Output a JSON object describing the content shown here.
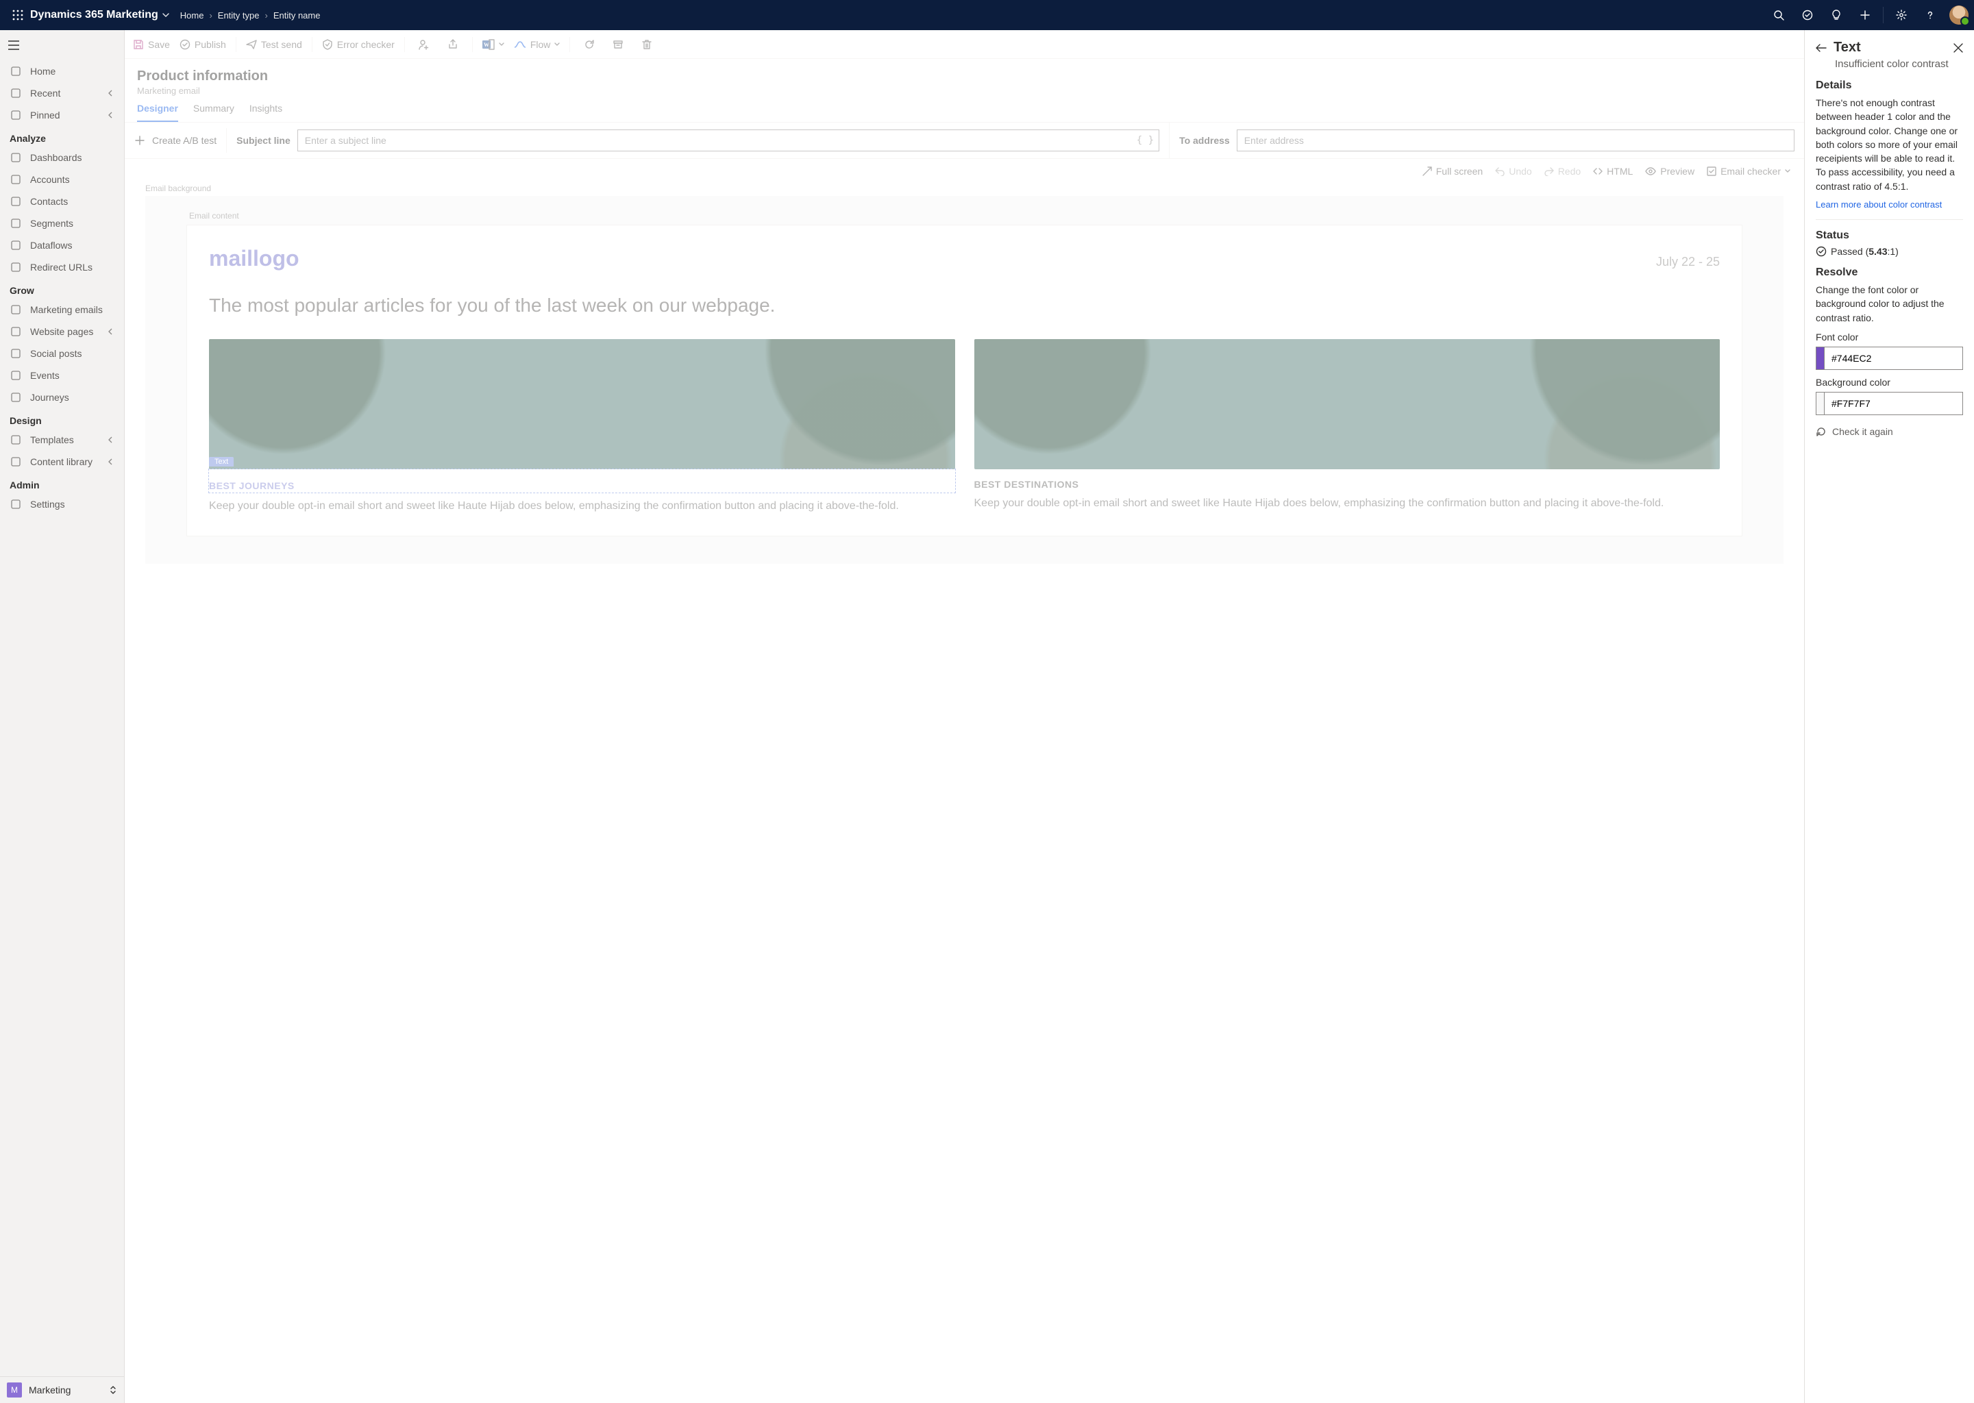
{
  "header": {
    "app_name": "Dynamics 365 Marketing",
    "breadcrumb": [
      "Home",
      "Entity type",
      "Entity name"
    ]
  },
  "sidebar": {
    "items_top": [
      {
        "icon": "home",
        "label": "Home"
      },
      {
        "icon": "clock",
        "label": "Recent",
        "expand": true
      },
      {
        "icon": "pin",
        "label": "Pinned",
        "expand": true
      }
    ],
    "groups": [
      {
        "label": "Analyze",
        "items": [
          {
            "icon": "dash",
            "label": "Dashboards"
          },
          {
            "icon": "briefcase",
            "label": "Accounts"
          },
          {
            "icon": "person",
            "label": "Contacts"
          },
          {
            "icon": "seg",
            "label": "Segments"
          },
          {
            "icon": "flow",
            "label": "Dataflows"
          },
          {
            "icon": "redir",
            "label": "Redirect URLs"
          }
        ]
      },
      {
        "label": "Grow",
        "items": [
          {
            "icon": "mail",
            "label": "Marketing emails"
          },
          {
            "icon": "page",
            "label": "Website pages",
            "expand": true
          },
          {
            "icon": "share",
            "label": "Social posts"
          },
          {
            "icon": "cal",
            "label": "Events"
          },
          {
            "icon": "journey",
            "label": "Journeys"
          }
        ]
      },
      {
        "label": "Design",
        "items": [
          {
            "icon": "template",
            "label": "Templates",
            "expand": true
          },
          {
            "icon": "library",
            "label": "Content library",
            "expand": true
          }
        ]
      },
      {
        "label": "Admin",
        "items": [
          {
            "icon": "gear",
            "label": "Settings"
          }
        ]
      }
    ],
    "area": {
      "initial": "M",
      "label": "Marketing"
    }
  },
  "cmdbar": {
    "save": "Save",
    "publish": "Publish",
    "test": "Test send",
    "error": "Error checker",
    "flow": "Flow"
  },
  "page": {
    "title": "Product information",
    "subtitle": "Marketing email"
  },
  "tabs": [
    "Designer",
    "Summary",
    "Insights"
  ],
  "fields": {
    "ab": "Create A/B test",
    "subject_lbl": "Subject line",
    "subject_ph": "Enter a subject line",
    "to_lbl": "To address",
    "to_ph": "Enter address"
  },
  "tools": {
    "full": "Full screen",
    "undo": "Undo",
    "redo": "Redo",
    "html": "HTML",
    "preview": "Preview",
    "checker": "Email checker"
  },
  "email": {
    "bg_label": "Email background",
    "content_label": "Email content",
    "logo": "maillogo",
    "date": "July 22 - 25",
    "headline": "The most popular articles for you of the last week on our webpage.",
    "cards": [
      {
        "cat": "BEST JOURNEYS",
        "desc": "Keep your double opt-in email short and sweet like Haute Hijab does below, emphasizing the confirmation button and placing it above-the-fold."
      },
      {
        "cat": "BEST DESTINATIONS",
        "desc": "Keep your double opt-in email short and sweet like Haute Hijab does below, emphasizing the confirmation button and placing it above-the-fold."
      }
    ],
    "sel_tag": "Text"
  },
  "panel": {
    "title": "Text",
    "subtitle": "Insufficient color contrast",
    "details_h": "Details",
    "details": "There's not enough contrast between header 1 color and the background color. Change one or both colors so more of your email receipients will be able to read it. To pass accessibility, you need a contrast ratio of 4.5:1.",
    "link": "Learn more about color contrast",
    "status_h": "Status",
    "status_text": "Passed (",
    "status_bold": "5.43",
    "status_tail": ":1)",
    "resolve_h": "Resolve",
    "resolve": "Change the font color or background color to adjust the contrast ratio.",
    "font_lbl": "Font color",
    "font_val": "#744EC2",
    "font_swatch": "#744EC2",
    "bg_lbl": "Background color",
    "bg_val": "#F7F7F7",
    "bg_swatch": "#F7F7F7",
    "check": "Check it again"
  }
}
